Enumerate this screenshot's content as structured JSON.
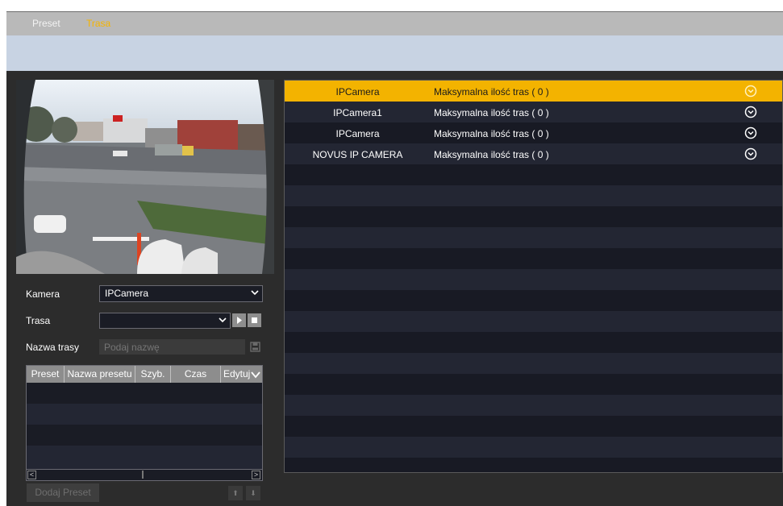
{
  "tabs": [
    {
      "label": "Preset",
      "active": false
    },
    {
      "label": "Trasa",
      "active": true
    }
  ],
  "form": {
    "camera_label": "Kamera",
    "camera_value": "IPCamera",
    "route_label": "Trasa",
    "route_value": "",
    "route_name_label": "Nazwa trasy",
    "route_name_placeholder": "Podaj nazwę"
  },
  "preset_table": {
    "columns": [
      "Preset",
      "Nazwa presetu",
      "Szyb.",
      "Czas",
      "Edytuj"
    ],
    "rows": []
  },
  "buttons": {
    "add_preset": "Dodaj Preset",
    "up": "⬆",
    "down": "⬇"
  },
  "cameras": [
    {
      "name": "IPCamera",
      "info": "Maksymalna ilość tras ( 0 )",
      "selected": true
    },
    {
      "name": "IPCamera1",
      "info": "Maksymalna ilość tras ( 0 )",
      "selected": false
    },
    {
      "name": "IPCamera",
      "info": "Maksymalna ilość tras ( 0 )",
      "selected": false
    },
    {
      "name": "NOVUS IP CAMERA",
      "info": "Maksymalna ilość tras ( 0 )",
      "selected": false
    }
  ],
  "colors": {
    "accent": "#f3b300",
    "panel_bg": "#181a24",
    "header_band": "#c8d3e3"
  },
  "icons": {
    "row_action": "circle-chevron-down-icon",
    "play": "play-icon",
    "stop": "stop-icon",
    "save": "save-icon"
  }
}
